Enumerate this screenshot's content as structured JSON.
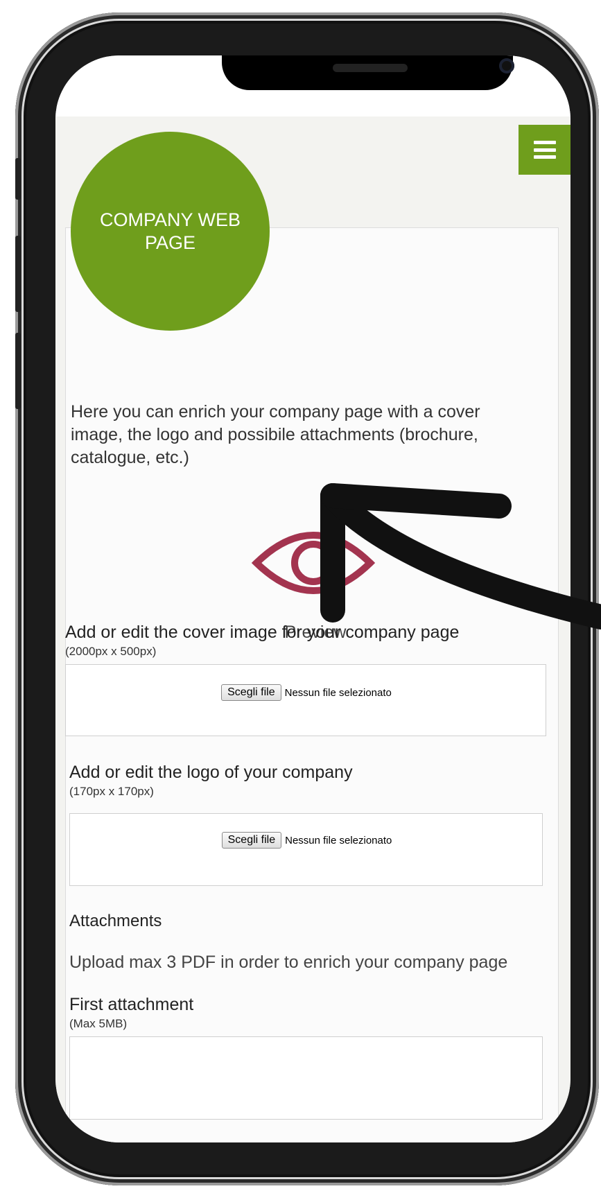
{
  "header": {
    "logo_text": "COMPANY WEB PAGE",
    "menu_icon": "hamburger-menu-icon",
    "brand_color": "#6f9e1c"
  },
  "intro": {
    "text": "Here you can enrich your company page with a cover image, the logo and possibile attachments (brochure, catalogue, etc.)"
  },
  "preview": {
    "icon": "eye-icon",
    "icon_color": "#a3344f",
    "label": "Preview"
  },
  "cover": {
    "label": "Add or edit the cover image for your company page",
    "hint": "(2000px x 500px)",
    "button": "Scegli file",
    "status": "Nessun file selezionato"
  },
  "logo": {
    "label": "Add or edit the logo of your company",
    "hint": "(170px x 170px)",
    "button": "Scegli file",
    "status": "Nessun file selezionato"
  },
  "attachments": {
    "title": "Attachments",
    "description": "Upload max 3 PDF in order to enrich your company page",
    "first_label": "First attachment",
    "first_hint": "(Max 5MB)"
  }
}
